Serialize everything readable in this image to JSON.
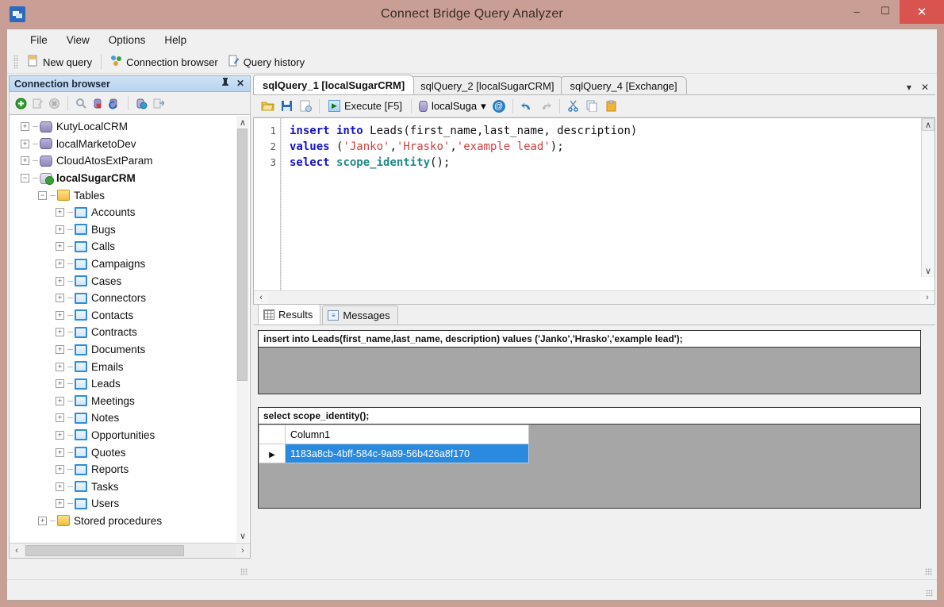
{
  "window": {
    "title": "Connect Bridge Query Analyzer",
    "app_icon": "app-icon",
    "minimize": "–",
    "maximize": "☐",
    "close": "✕"
  },
  "menu": {
    "items": [
      "File",
      "View",
      "Options",
      "Help"
    ]
  },
  "toolbar": {
    "new_query": "New query",
    "connection_browser": "Connection browser",
    "query_history": "Query history"
  },
  "dock": {
    "title": "Connection browser",
    "pin": "📌",
    "close": "✕",
    "tools": [
      "add-connection-icon",
      "edit-connection-icon",
      "delete-connection-icon",
      "find-icon",
      "remove-db-icon",
      "refresh-db-icon",
      "globe-db-icon",
      "export-icon"
    ],
    "tree": [
      {
        "label": "KutyLocalCRM",
        "icon": "database-icon",
        "indent": 0,
        "expander": "+",
        "bold": false
      },
      {
        "label": "localMarketoDev",
        "icon": "database-icon",
        "indent": 0,
        "expander": "+",
        "bold": false
      },
      {
        "label": "CloudAtosExtParam",
        "icon": "database-icon",
        "indent": 0,
        "expander": "+",
        "bold": false
      },
      {
        "label": "localSugarCRM",
        "icon": "database-connected-icon",
        "indent": 0,
        "expander": "−",
        "bold": true
      },
      {
        "label": "Tables",
        "icon": "folder-icon",
        "indent": 1,
        "expander": "−",
        "bold": false
      },
      {
        "label": "Accounts",
        "icon": "table-icon",
        "indent": 2,
        "expander": "+",
        "bold": false
      },
      {
        "label": "Bugs",
        "icon": "table-icon",
        "indent": 2,
        "expander": "+",
        "bold": false
      },
      {
        "label": "Calls",
        "icon": "table-icon",
        "indent": 2,
        "expander": "+",
        "bold": false
      },
      {
        "label": "Campaigns",
        "icon": "table-icon",
        "indent": 2,
        "expander": "+",
        "bold": false
      },
      {
        "label": "Cases",
        "icon": "table-icon",
        "indent": 2,
        "expander": "+",
        "bold": false
      },
      {
        "label": "Connectors",
        "icon": "table-icon",
        "indent": 2,
        "expander": "+",
        "bold": false
      },
      {
        "label": "Contacts",
        "icon": "table-icon",
        "indent": 2,
        "expander": "+",
        "bold": false
      },
      {
        "label": "Contracts",
        "icon": "table-icon",
        "indent": 2,
        "expander": "+",
        "bold": false
      },
      {
        "label": "Documents",
        "icon": "table-icon",
        "indent": 2,
        "expander": "+",
        "bold": false
      },
      {
        "label": "Emails",
        "icon": "table-icon",
        "indent": 2,
        "expander": "+",
        "bold": false
      },
      {
        "label": "Leads",
        "icon": "table-icon",
        "indent": 2,
        "expander": "+",
        "bold": false
      },
      {
        "label": "Meetings",
        "icon": "table-icon",
        "indent": 2,
        "expander": "+",
        "bold": false
      },
      {
        "label": "Notes",
        "icon": "table-icon",
        "indent": 2,
        "expander": "+",
        "bold": false
      },
      {
        "label": "Opportunities",
        "icon": "table-icon",
        "indent": 2,
        "expander": "+",
        "bold": false
      },
      {
        "label": "Quotes",
        "icon": "table-icon",
        "indent": 2,
        "expander": "+",
        "bold": false
      },
      {
        "label": "Reports",
        "icon": "table-icon",
        "indent": 2,
        "expander": "+",
        "bold": false
      },
      {
        "label": "Tasks",
        "icon": "table-icon",
        "indent": 2,
        "expander": "+",
        "bold": false
      },
      {
        "label": "Users",
        "icon": "table-icon",
        "indent": 2,
        "expander": "+",
        "bold": false
      },
      {
        "label": "Stored procedures",
        "icon": "folder-icon",
        "indent": 1,
        "expander": "+",
        "bold": false
      }
    ]
  },
  "tabs": {
    "items": [
      {
        "label": "sqlQuery_1 [localSugarCRM]",
        "active": true
      },
      {
        "label": "sqlQuery_2 [localSugarCRM]",
        "active": false
      },
      {
        "label": "sqlQuery_4 [Exchange]",
        "active": false
      }
    ],
    "dropdown": "▾",
    "close": "✕"
  },
  "editor_toolbar": {
    "open": "open-folder-icon",
    "save": "save-icon",
    "save_as": "save-as-icon",
    "execute_label": "Execute [F5]",
    "execute_glyph": "▶",
    "database": "localSuga",
    "dropdown": "▾",
    "at": "@",
    "undo": "↶",
    "redo": "↷",
    "cut": "✂",
    "copy": "copy-icon",
    "paste": "paste-icon"
  },
  "editor": {
    "line_numbers": [
      "1",
      "2",
      "3"
    ],
    "lines": [
      [
        {
          "t": "insert into ",
          "c": "k"
        },
        {
          "t": "Leads",
          "c": "p"
        },
        {
          "t": "(first_name,last_name, description)",
          "c": "p"
        }
      ],
      [
        {
          "t": "values ",
          "c": "k"
        },
        {
          "t": "(",
          "c": "p"
        },
        {
          "t": "'Janko'",
          "c": "s"
        },
        {
          "t": ",",
          "c": "p"
        },
        {
          "t": "'Hrasko'",
          "c": "s"
        },
        {
          "t": ",",
          "c": "p"
        },
        {
          "t": "'example lead'",
          "c": "s"
        },
        {
          "t": ");",
          "c": "p"
        }
      ],
      [
        {
          "t": "select ",
          "c": "k"
        },
        {
          "t": "scope_identity",
          "c": "f"
        },
        {
          "t": "();",
          "c": "p"
        }
      ]
    ],
    "scroll_up": "∧",
    "scroll_down": "∨",
    "scroll_left": "‹",
    "scroll_right": "›"
  },
  "results": {
    "tabs": [
      {
        "label": "Results",
        "icon": "grid-icon",
        "active": true
      },
      {
        "label": "Messages",
        "icon": "messages-icon",
        "active": false
      }
    ],
    "blocks": [
      {
        "header": "insert into Leads(first_name,last_name, description) values ('Janko','Hrasko','example lead');",
        "has_grid": false
      },
      {
        "header": "select scope_identity();",
        "has_grid": true,
        "columns": [
          "Column1"
        ],
        "rows": [
          {
            "marker": "▶",
            "cells": [
              "1183a8cb-4bff-584c-9a89-56b426a8f170"
            ],
            "selected": true
          }
        ]
      }
    ]
  },
  "colors": {
    "window_chrome": "#c99e94",
    "titlebar_text": "#3b2a26",
    "close_button": "#d9534f",
    "dock_header": "#b9d4ef",
    "selection": "#2a8ae0",
    "keyword": "#1414c8",
    "string": "#d0413c",
    "function": "#1f8a8a",
    "grid_background": "#a6a6a6"
  }
}
